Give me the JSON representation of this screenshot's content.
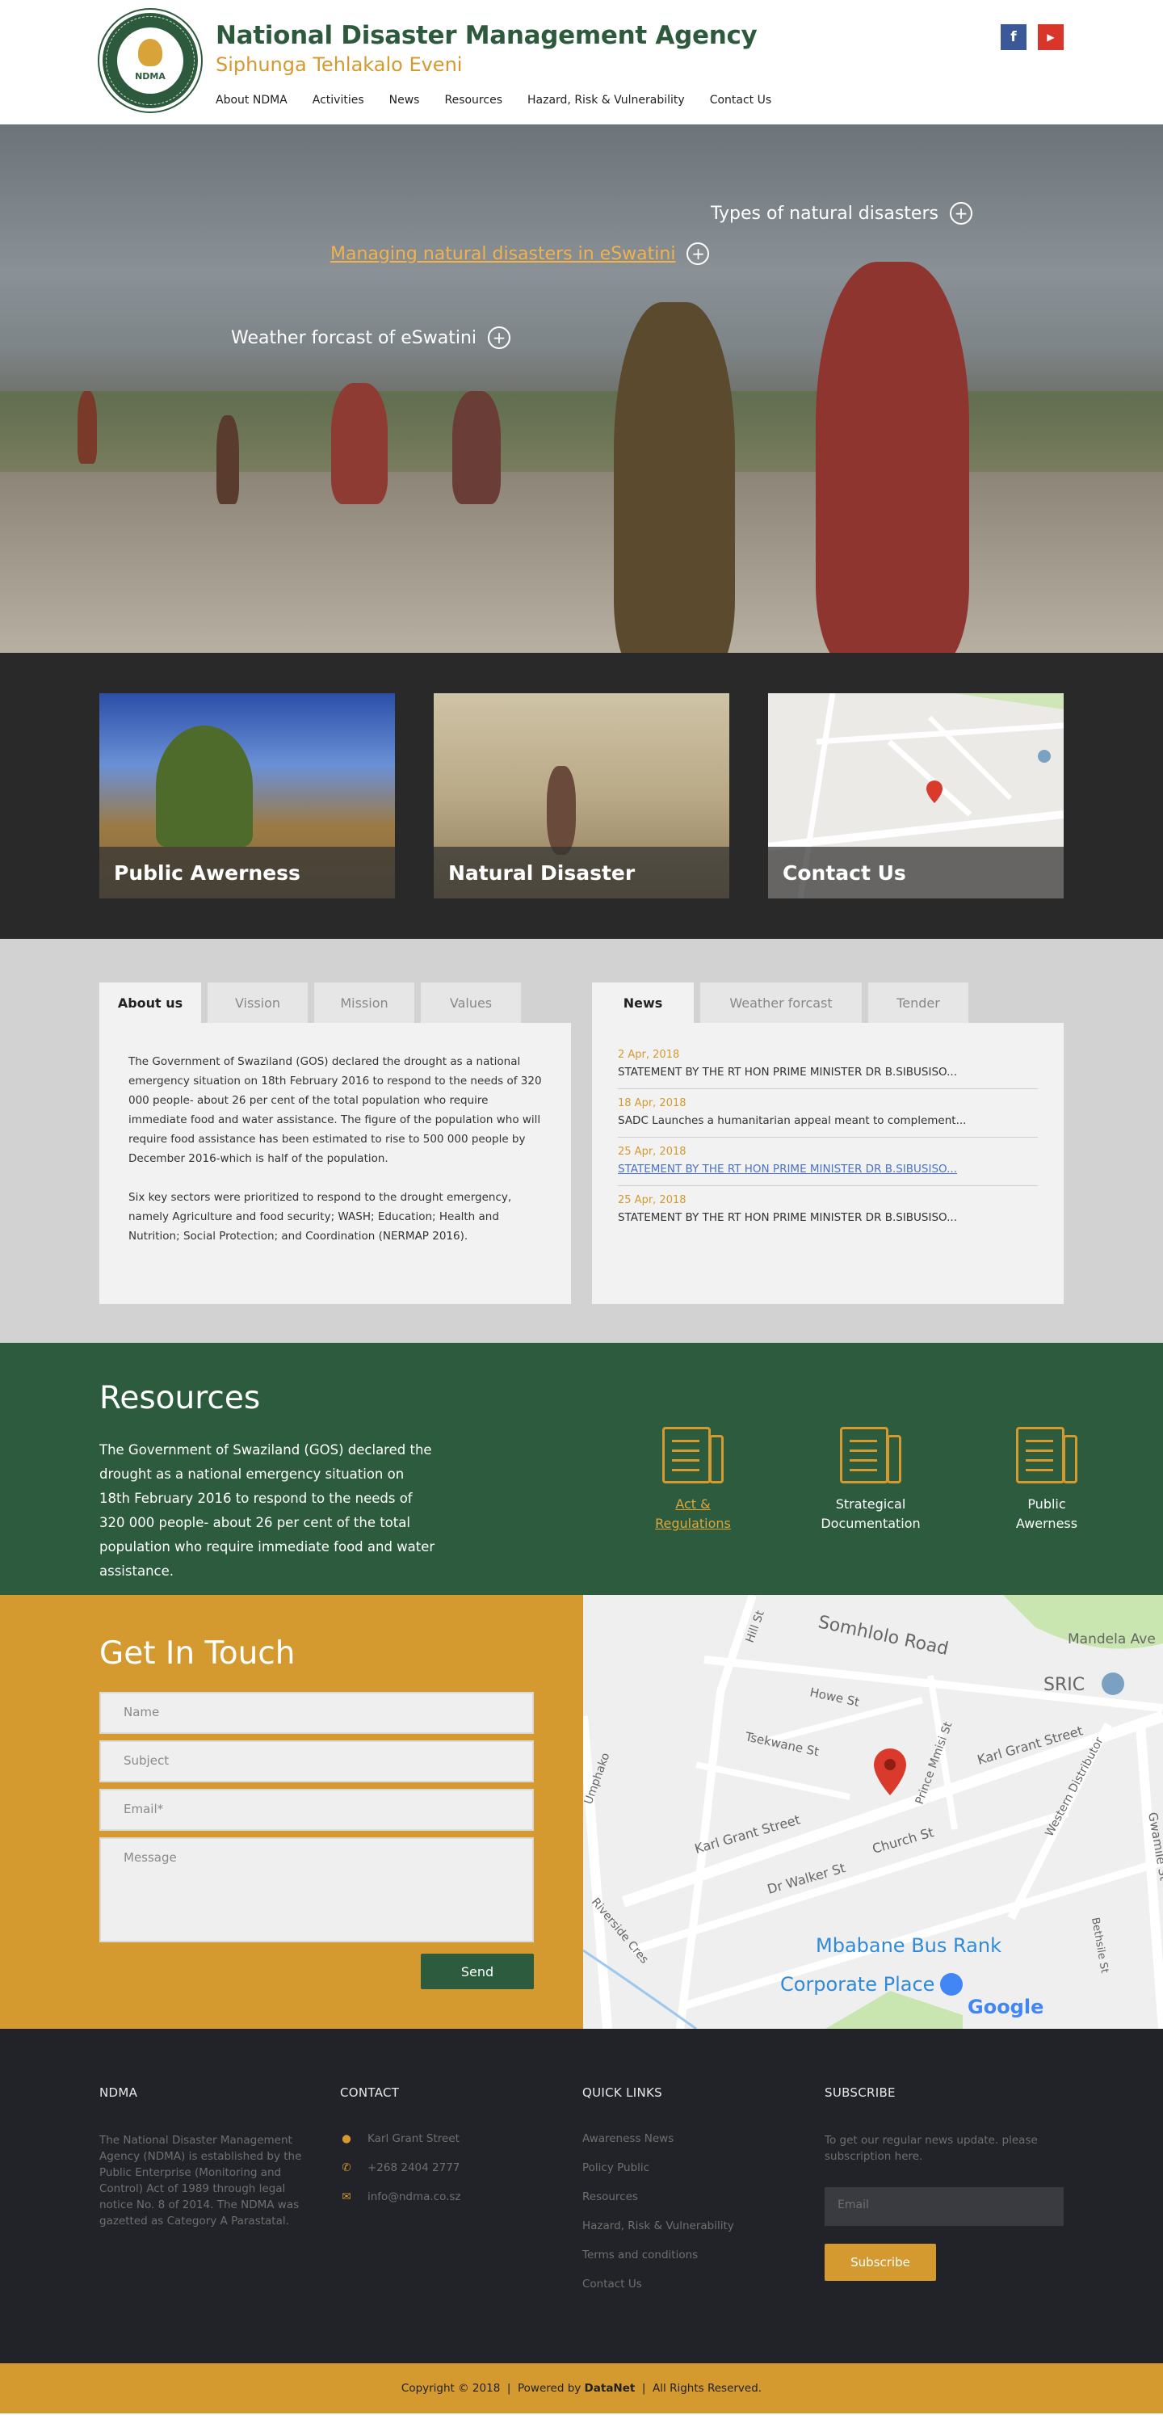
{
  "header": {
    "logo_text": "NDMA",
    "title": "National Disaster Management Agency",
    "subtitle": "Siphunga Tehlakalo Eveni",
    "nav": [
      "About NDMA",
      "Activities",
      "News",
      "Resources",
      "Hazard, Risk & Vulnerability",
      "Contact Us"
    ],
    "social": {
      "facebook": "f",
      "youtube": "▶"
    }
  },
  "hero": {
    "link1": "Types of natural disasters",
    "link2": "Managing natural disasters in eSwatini",
    "link3": "Weather forcast of eSwatini"
  },
  "cards": [
    "Public Awerness",
    "Natural Disaster",
    "Contact Us"
  ],
  "about": {
    "tabs": [
      "About us",
      "Vission",
      "Mission",
      "Values"
    ],
    "p1": "The Government of Swaziland (GOS) declared the drought as a national emergency situation on 18th February 2016 to respond to the needs of 320 000 people- about 26 per cent of the total population who require immediate food and water assistance. The figure of the population who will require food assistance has been estimated to rise to 500 000 people by December 2016-which is half of the population.",
    "p2": "Six key sectors were prioritized to respond to the drought emergency, namely Agriculture and food security; WASH; Education; Health and Nutrition; Social Protection; and Coordination (NERMAP 2016)."
  },
  "news": {
    "tabs": [
      "News",
      "Weather forcast",
      "Tender"
    ],
    "items": [
      {
        "date": "2 Apr, 2018",
        "title": "STATEMENT BY THE RT HON PRIME MINISTER DR B.SIBUSISO..."
      },
      {
        "date": "18 Apr, 2018",
        "title": "SADC Launches a humanitarian appeal meant to complement..."
      },
      {
        "date": "25 Apr, 2018",
        "title": "STATEMENT BY THE RT HON PRIME MINISTER DR B.SIBUSISO..."
      },
      {
        "date": "25 Apr, 2018",
        "title": "STATEMENT BY THE RT HON PRIME MINISTER DR B.SIBUSISO..."
      }
    ]
  },
  "resources": {
    "title": "Resources",
    "text": "The Government of Swaziland (GOS) declared the drought as a national emergency situation on 18th February 2016 to respond to the needs of 320 000 people- about 26 per cent of the total population who require immediate food and water assistance.",
    "items": [
      {
        "line1": "Act &",
        "line2": "Regulations"
      },
      {
        "line1": "Strategical",
        "line2": "Documentation"
      },
      {
        "line1": "Public",
        "line2": "Awerness"
      }
    ]
  },
  "contact": {
    "title": "Get In Touch",
    "name_ph": "Name",
    "subject_ph": "Subject",
    "email_ph": "Email*",
    "message_ph": "Message",
    "send": "Send"
  },
  "map": {
    "streets": [
      "Somhlolo Road",
      "Mandela Ave",
      "Howe St",
      "Tsekwane St",
      "Prince Mmisi St",
      "Karl Grant Street",
      "Karl Grant Street",
      "Church St",
      "Dr Walker St",
      "Western Distributor",
      "Gwamile St",
      "Umphako",
      "Riverside Cres",
      "Bethsile St",
      "Hill St"
    ],
    "places": [
      "SRIC",
      "Mbabane Bus Rank",
      "Corporate Place"
    ],
    "brand": "Google"
  },
  "footer": {
    "ndma_h": "NDMA",
    "ndma_text": "The National Disaster Management Agency (NDMA) is established by the Public Enterprise (Monitoring and Control) Act of 1989 through legal notice No. 8 of 2014. The NDMA was gazetted as Category A Parastatal.",
    "contact_h": "CONTACT",
    "address": "Karl Grant Street",
    "phone": "+268 2404 2777",
    "email": "info@ndma.co.sz",
    "links_h": "QUICK LINKS",
    "links": [
      "Awareness News",
      "Policy Public",
      "Resources",
      "Hazard, Risk & Vulnerability",
      "Terms and conditions",
      "Contact Us"
    ],
    "sub_h": "SUBSCRIBE",
    "sub_text": "To get our regular news update. please subscription here.",
    "sub_ph": "Email",
    "sub_btn": "Subscribe"
  },
  "copyright": {
    "pre": "Copyright © 2018  |  Powered by ",
    "brand": "DataNet",
    "post": "  |  All Rights Reserved."
  }
}
